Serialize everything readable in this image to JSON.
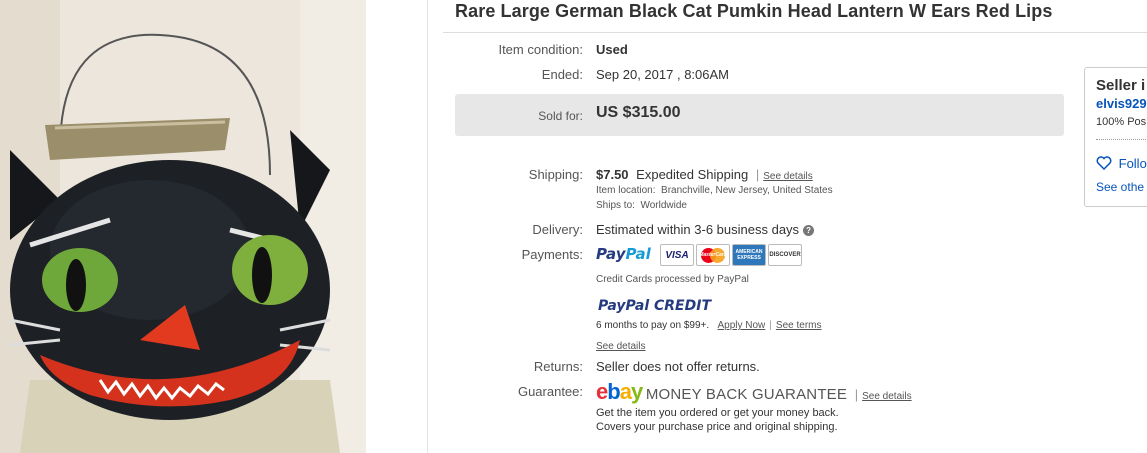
{
  "listing": {
    "title": "Rare Large German Black Cat Pumkin Head Lantern W Ears Red Lips"
  },
  "item": {
    "condition_label": "Item condition:",
    "condition_value": "Used",
    "ended_label": "Ended:",
    "ended_date": "Sep 20, 2017",
    "ended_time": "8:06AM",
    "sold_label": "Sold for:",
    "sold_price": "US $315.00"
  },
  "shipping": {
    "label": "Shipping:",
    "cost": "$7.50",
    "method": "Expedited Shipping",
    "see_details": "See details",
    "location_label": "Item location:",
    "location": "Branchville, New Jersey, United States",
    "ships_to_label": "Ships to:",
    "ships_to": "Worldwide"
  },
  "delivery": {
    "label": "Delivery:",
    "estimate": "Estimated within 3-6 business days",
    "help_icon": "?"
  },
  "payments": {
    "label": "Payments:",
    "paypal_dark": "Pay",
    "paypal_light": "Pal",
    "cards": [
      "VISA",
      "MasterCard",
      "AMERICAN EXPRESS",
      "DISCOVER"
    ],
    "cc_note": "Credit Cards processed by PayPal",
    "credit_dark": "PayPal",
    "credit_light": "CREDIT",
    "credit_terms": "6 months to pay on $99+.",
    "apply_now": "Apply Now",
    "see_terms": "See terms",
    "see_details": "See details"
  },
  "returns": {
    "label": "Returns:",
    "value": "Seller does not offer returns."
  },
  "guarantee": {
    "label": "Guarantee:",
    "ebay_letters": [
      "e",
      "b",
      "a",
      "y"
    ],
    "mbg": "MONEY BACK GUARANTEE",
    "see_details": "See details",
    "line1": "Get the item you ordered or get your money back.",
    "line2": "Covers your purchase price and original shipping."
  },
  "seller": {
    "title": "Seller i",
    "name": "elvis929",
    "positive": "100% Pos",
    "follow": "Follo",
    "see_other": "See othe"
  },
  "colors": {
    "link": "#0654ba",
    "sold_box": "#e7e7e7",
    "paypal_dark": "#253b80",
    "paypal_light": "#179bd7"
  }
}
